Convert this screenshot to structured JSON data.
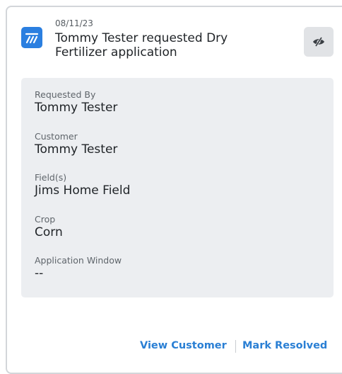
{
  "notification": {
    "date": "08/11/23",
    "title": "Tommy Tester requested Dry Fertilizer application",
    "app_icon": "dry-fertilizer-icon",
    "hide_icon": "eye-slash-icon",
    "accent_color": "#2b7fe0"
  },
  "details": {
    "fields": [
      {
        "label": "Requested By",
        "value": "Tommy Tester"
      },
      {
        "label": "Customer",
        "value": "Tommy Tester"
      },
      {
        "label": "Field(s)",
        "value": "Jims Home Field"
      },
      {
        "label": "Crop",
        "value": "Corn"
      },
      {
        "label": "Application Window",
        "value": "--"
      }
    ]
  },
  "actions": {
    "view_customer": "View Customer",
    "mark_resolved": "Mark Resolved",
    "link_color": "#2a7fd4"
  }
}
